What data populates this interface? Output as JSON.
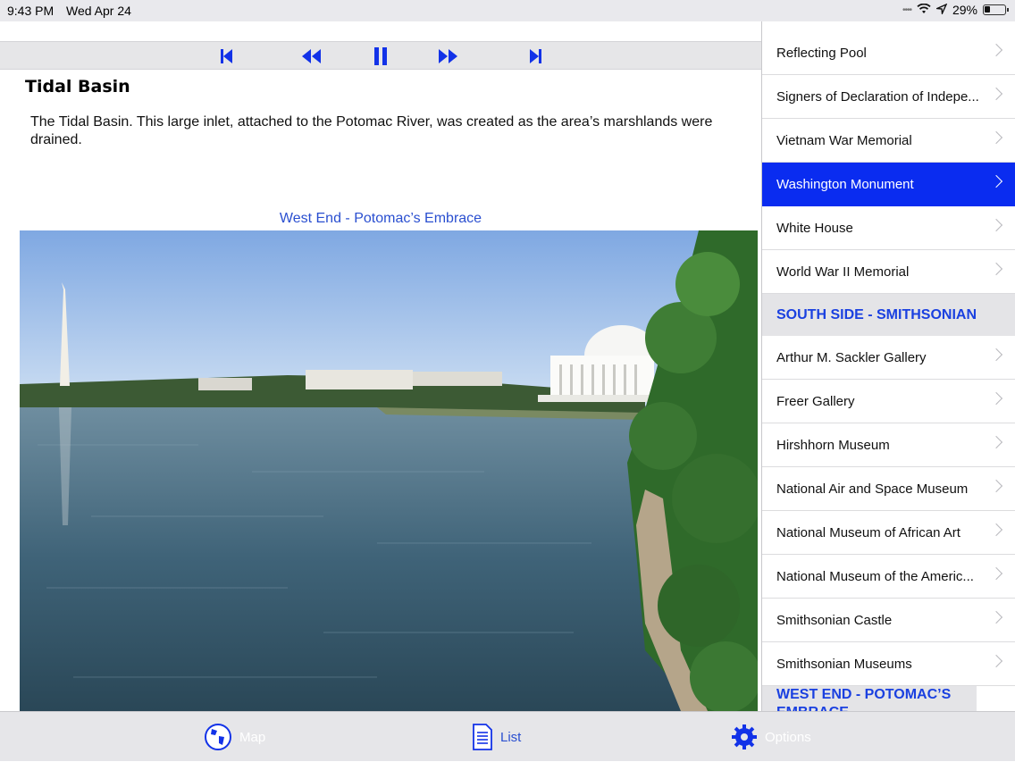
{
  "status": {
    "time": "9:43 PM",
    "date": "Wed Apr 24",
    "battery": "29%"
  },
  "player": {
    "buttons": [
      "skip-back",
      "rewind",
      "pause",
      "fast-forward",
      "skip-forward"
    ]
  },
  "content": {
    "title": "Tidal Basin",
    "description": "The Tidal Basin. This large inlet, attached to the Potomac River, was created as the area’s marshlands were drained.",
    "caption": "West End - Potomac’s Embrace"
  },
  "sidebar": {
    "items_top": [
      {
        "label": "Reflecting Pool"
      },
      {
        "label": "Signers of Declaration of Indepe..."
      },
      {
        "label": "Vietnam War Memorial"
      },
      {
        "label": "Washington Monument",
        "selected": true
      },
      {
        "label": "White House"
      },
      {
        "label": "World War II Memorial"
      }
    ],
    "section1": "SOUTH SIDE - SMITHSONIAN",
    "items_south": [
      {
        "label": "Arthur M. Sackler Gallery"
      },
      {
        "label": "Freer Gallery"
      },
      {
        "label": "Hirshhorn Museum"
      },
      {
        "label": "National Air and Space Museum"
      },
      {
        "label": "National Museum of African Art"
      },
      {
        "label": "National Museum of the Americ..."
      },
      {
        "label": "Smithsonian Castle"
      },
      {
        "label": "Smithsonian Museums"
      }
    ],
    "section2": "WEST END - POTOMAC’S EMBRACE"
  },
  "tabs": {
    "map": "Map",
    "list": "List",
    "options": "Options"
  },
  "colors": {
    "accent": "#0a2cf0",
    "link": "#2a4fd0"
  }
}
